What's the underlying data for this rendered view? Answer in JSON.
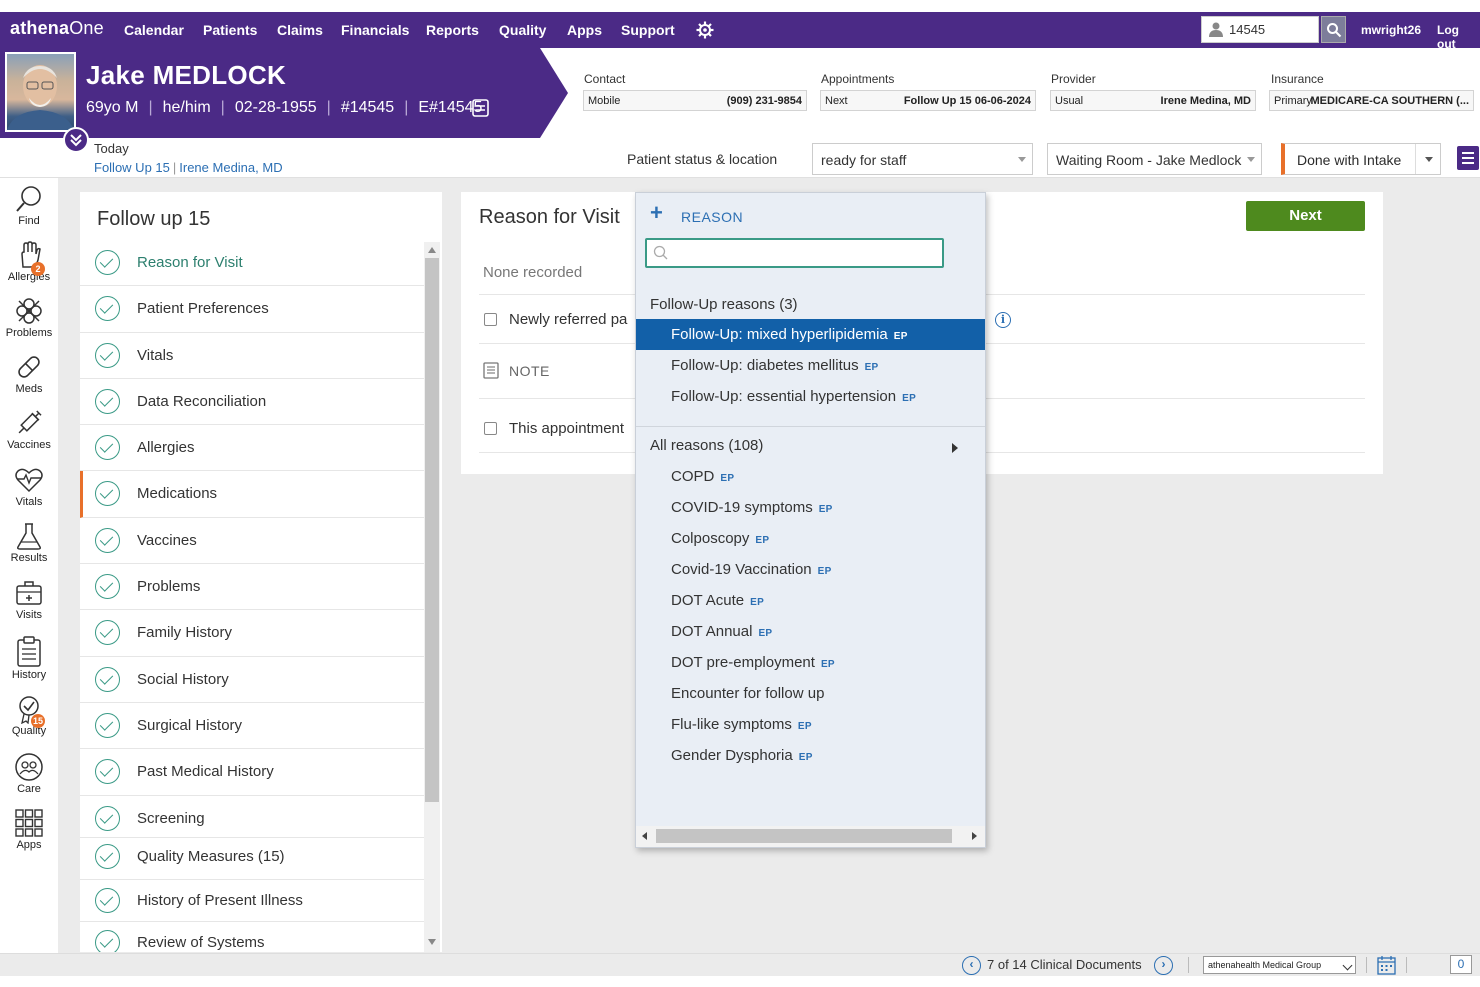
{
  "nav": {
    "logo": "athenaOne",
    "items": [
      "Calendar",
      "Patients",
      "Claims",
      "Financials",
      "Reports",
      "Quality",
      "Apps",
      "Support"
    ],
    "search_value": "14545",
    "user": "mwright26",
    "logout": "Log out"
  },
  "patient": {
    "name_first": "Jake",
    "name_last": "MEDLOCK",
    "age_sex": "69yo M",
    "pronouns": "he/him",
    "dob": "02-28-1955",
    "mrn": "#14545",
    "enterprise_id": "E#14545"
  },
  "info": {
    "contact": {
      "label": "Contact",
      "key": "Mobile",
      "value": "(909) 231-9854"
    },
    "appointments": {
      "label": "Appointments",
      "key": "Next",
      "value": "Follow Up 15 06-06-2024"
    },
    "provider": {
      "label": "Provider",
      "key": "Usual",
      "value": "Irene Medina, MD"
    },
    "insurance": {
      "label": "Insurance",
      "key": "Primary",
      "value": "MEDICARE-CA SOUTHERN (..."
    }
  },
  "visit": {
    "when": "Today",
    "type": "Follow Up 15",
    "provider": "Irene Medina, MD"
  },
  "status": {
    "label": "Patient status & location",
    "status_value": "ready for staff",
    "location_value": "Waiting Room - Jake Medlock",
    "done_label": "Done with Intake"
  },
  "rail": {
    "items": [
      "Find",
      "Allergies",
      "Problems",
      "Meds",
      "Vaccines",
      "Vitals",
      "Results",
      "Visits",
      "History",
      "Quality",
      "Care",
      "Apps"
    ],
    "allergies_badge": "2",
    "quality_badge": "15"
  },
  "checklist": {
    "title": "Follow up 15",
    "items": [
      "Reason for Visit",
      "Patient Preferences",
      "Vitals",
      "Data Reconciliation",
      "Allergies",
      "Medications",
      "Vaccines",
      "Problems",
      "Family History",
      "Social History",
      "Surgical History",
      "Past Medical History",
      "Screening",
      "Quality Measures (15)",
      "History of Present Illness",
      "Review of Systems"
    ]
  },
  "reason": {
    "title": "Reason for Visit",
    "none_recorded": "None recorded",
    "newly_referred": "Newly referred pa",
    "note": "NOTE",
    "appointment": "This appointment",
    "next": "Next"
  },
  "dropdown": {
    "add_label": "REASON",
    "search_value": "",
    "followup_header": "Follow-Up reasons (3)",
    "followup": [
      {
        "label": "Follow-Up: mixed hyperlipidemia",
        "tag": "EP",
        "highlighted": true
      },
      {
        "label": "Follow-Up: diabetes mellitus",
        "tag": "EP"
      },
      {
        "label": "Follow-Up: essential hypertension",
        "tag": "EP"
      }
    ],
    "all_header": "All reasons (108)",
    "all": [
      {
        "label": "COPD",
        "tag": "EP"
      },
      {
        "label": "COVID-19 symptoms",
        "tag": "EP"
      },
      {
        "label": "Colposcopy",
        "tag": "EP"
      },
      {
        "label": "Covid-19 Vaccination",
        "tag": "EP"
      },
      {
        "label": "DOT Acute",
        "tag": "EP"
      },
      {
        "label": "DOT Annual",
        "tag": "EP"
      },
      {
        "label": "DOT pre-employment",
        "tag": "EP"
      },
      {
        "label": "Encounter for follow up",
        "tag": ""
      },
      {
        "label": "Flu-like symptoms",
        "tag": "EP"
      },
      {
        "label": "Gender Dysphoria",
        "tag": "EP"
      }
    ]
  },
  "footer": {
    "doc_count": "7 of 14 Clinical Documents",
    "org": "athenahealth Medical Group",
    "count": "0"
  },
  "colors": {
    "brand": "#4b2a86",
    "accent": "#e8702a",
    "success": "#4e8a1e",
    "highlight": "#1260a8"
  }
}
